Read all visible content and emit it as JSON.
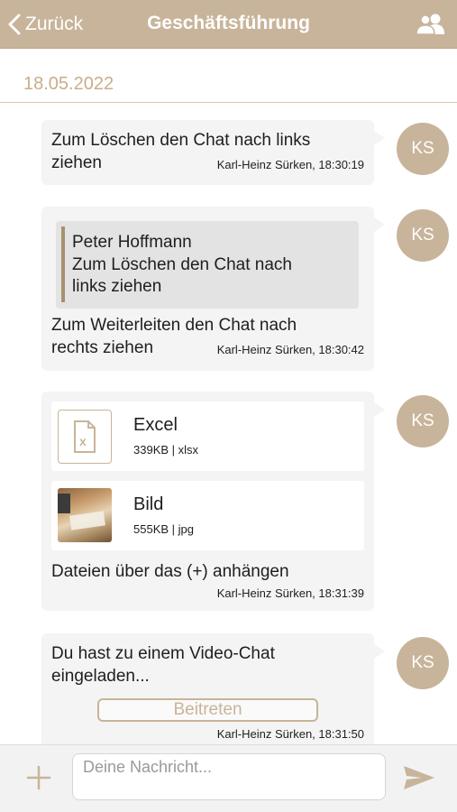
{
  "header": {
    "back_label": "Zurück",
    "title": "Geschäftsführung",
    "icon": "group-icon"
  },
  "date": "18.05.2022",
  "messages": [
    {
      "avatar": "KS",
      "line1": "Zum Löschen den Chat nach links",
      "line2": "ziehen",
      "meta": "Karl-Heinz Sürken, 18:30:19"
    },
    {
      "avatar": "KS",
      "quote": {
        "author": "Peter Hoffmann",
        "line1": "Zum Löschen den Chat nach",
        "line2": "links ziehen"
      },
      "line1": "Zum Weiterleiten den Chat nach",
      "line2": "rechts ziehen",
      "meta": "Karl-Heinz Sürken, 18:30:42"
    },
    {
      "avatar": "KS",
      "files": [
        {
          "name": "Excel",
          "info": "339KB | xlsx",
          "icon": "excel-file-icon"
        },
        {
          "name": "Bild",
          "info": "555KB | jpg",
          "icon": "image-thumbnail"
        }
      ],
      "line1": "Dateien über das (+) anhängen",
      "meta": "Karl-Heinz Sürken, 18:31:39"
    },
    {
      "avatar": "KS",
      "line1": "Du hast zu einem Video-Chat",
      "line2": "eingeladen...",
      "button": "Beitreten",
      "meta": "Karl-Heinz Sürken, 18:31:50"
    }
  ],
  "composer": {
    "placeholder": "Deine Nachricht...",
    "value": "",
    "plus_icon": "plus-icon",
    "send_icon": "send-icon"
  },
  "colors": {
    "accent": "#c8b49a",
    "bubble": "#f4f4f4",
    "quote_bg": "#e3e3e3",
    "date_text": "#c8ae8c"
  }
}
